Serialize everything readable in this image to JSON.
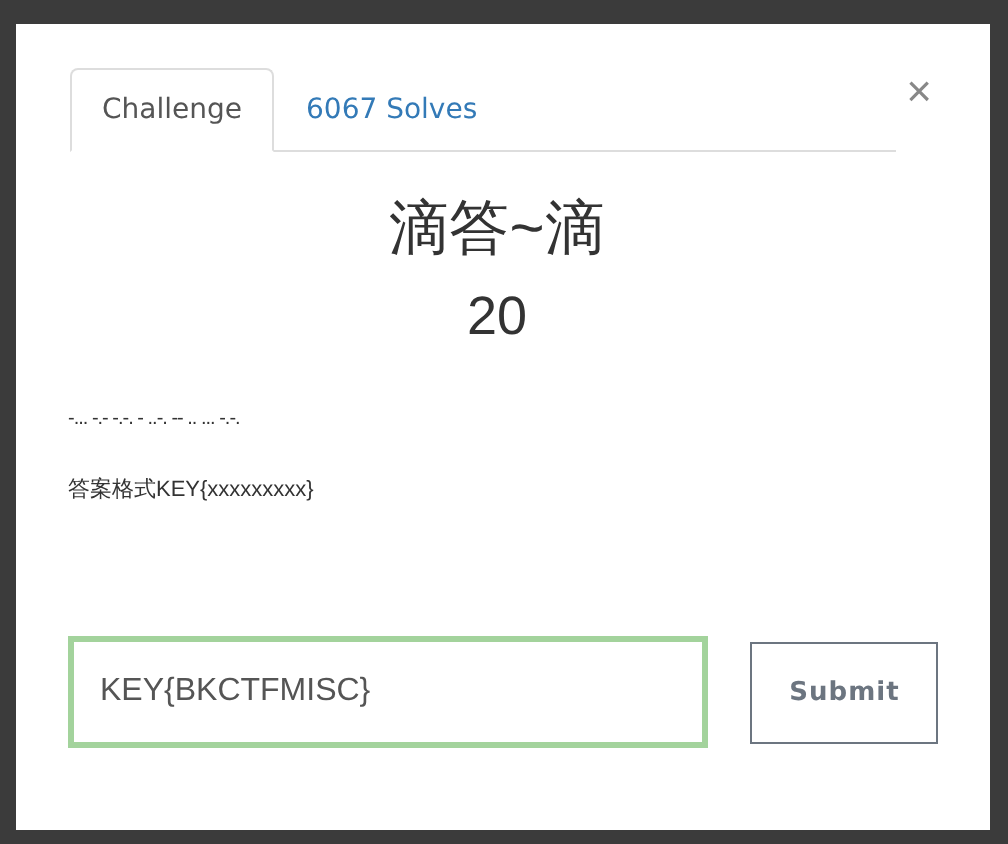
{
  "tabs": [
    {
      "label": "Challenge",
      "selected": true
    },
    {
      "label": "6067 Solves",
      "selected": false
    }
  ],
  "close": "×",
  "challenge": {
    "title": "滴答~滴",
    "points": "20",
    "description": [
      "-... -.- -.-. - ..-. -- .. ... -.-.",
      "答案格式KEY{xxxxxxxxx}"
    ]
  },
  "answer": {
    "value": "KEY{BKCTFMISC}"
  },
  "buttons": [
    "Submit"
  ]
}
